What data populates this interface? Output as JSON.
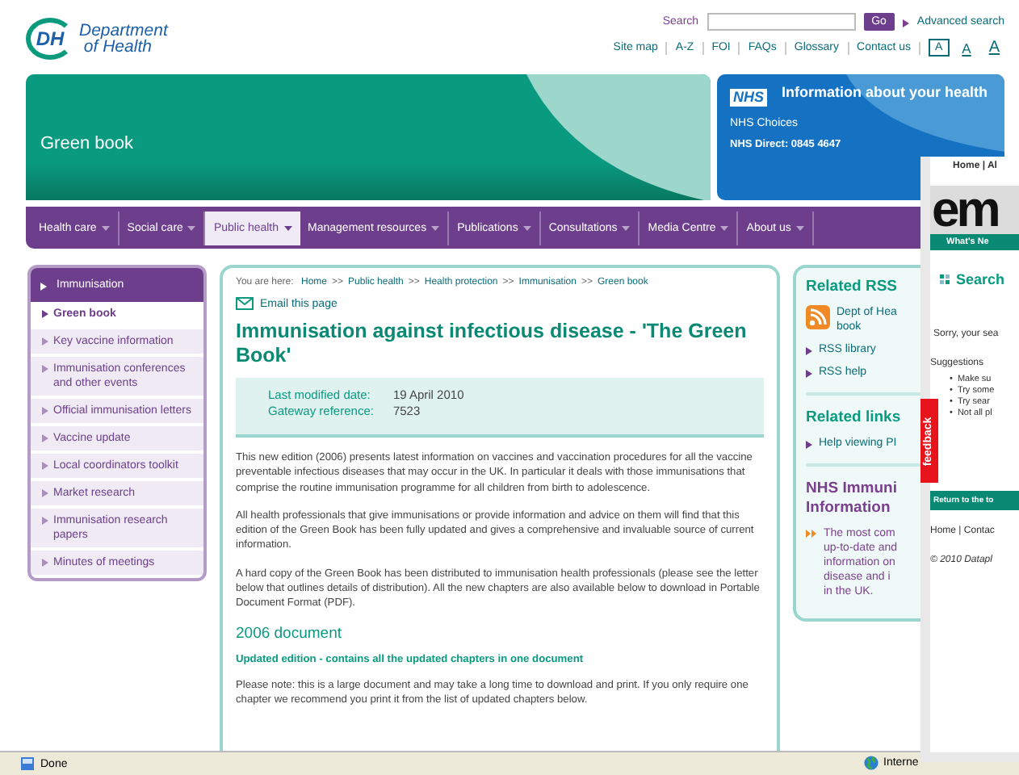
{
  "header": {
    "logo_mark": "DH",
    "logo_line1": "Department",
    "logo_line2": "of Health",
    "search_label": "Search",
    "go_button": "Go",
    "advanced_search": "Advanced search",
    "top_links": [
      "Site map",
      "A-Z",
      "FOI",
      "FAQs",
      "Glossary",
      "Contact us"
    ],
    "text_sizes": [
      {
        "label": "A",
        "selected": true
      },
      {
        "label": "A",
        "selected": false
      },
      {
        "label": "A",
        "selected": false
      }
    ]
  },
  "banner": {
    "title": "Green book",
    "nhs_logo": "NHS",
    "nhs_heading": "Information about your health",
    "nhs_link": "NHS Choices",
    "nhs_phone": "NHS Direct: 0845 4647"
  },
  "nav": [
    {
      "label": "Health care",
      "selected": false
    },
    {
      "label": "Social care",
      "selected": false
    },
    {
      "label": "Public health",
      "selected": true
    },
    {
      "label": "Management resources",
      "selected": false
    },
    {
      "label": "Publications",
      "selected": false
    },
    {
      "label": "Consultations",
      "selected": false
    },
    {
      "label": "Media Centre",
      "selected": false
    },
    {
      "label": "About us",
      "selected": false
    }
  ],
  "sidebar": {
    "heading": "Immunisation",
    "items": [
      {
        "label": "Green book",
        "selected": true
      },
      {
        "label": "Key vaccine information",
        "selected": false
      },
      {
        "label": "Immunisation conferences and other events",
        "selected": false
      },
      {
        "label": "Official immunisation letters",
        "selected": false
      },
      {
        "label": "Vaccine update",
        "selected": false
      },
      {
        "label": "Local coordinators toolkit",
        "selected": false
      },
      {
        "label": "Market research",
        "selected": false
      },
      {
        "label": "Immunisation research papers",
        "selected": false
      },
      {
        "label": "Minutes of meetings",
        "selected": false
      }
    ]
  },
  "main": {
    "breadcrumb_label": "You are here:",
    "breadcrumb": [
      "Home",
      "Public health",
      "Health protection",
      "Immunisation",
      "Green book"
    ],
    "breadcrumb_separator": ">>",
    "email_link": "Email this page",
    "title": "Immunisation against infectious disease - 'The Green Book'",
    "meta": [
      {
        "label": "Last modified date:",
        "value": "19 April 2010"
      },
      {
        "label": "Gateway reference:",
        "value": "7523"
      }
    ],
    "paragraphs": [
      "This new edition (2006) presents latest information on vaccines and vaccination procedures for all the vaccine preventable infectious diseases that may occur in the UK. In particular it deals with those immunisations that comprise the routine immunisation programme for all children from birth to adolescence.",
      "All health professionals that give immunisations or provide information and advice on them will find that this edition of the Green Book has been fully updated and gives a comprehensive and invaluable source of current information.",
      "A hard copy of the Green Book has been distributed to immunisation health professionals (please see the letter below that outlines details of distribution). All the new chapters are also available below to download in Portable Document Format (PDF)."
    ],
    "section_heading": "2006 document",
    "subheading": "Updated edition - contains all the updated chapters in one document",
    "note": "Please note: this is a large document and may take a long time to download and print.  If you only require one chapter we recommend you print it from the list of updated chapters below."
  },
  "right": {
    "rss_heading": "Related RSS",
    "rss_feed": [
      "Dept of Hea",
      "book"
    ],
    "rss_links": [
      "RSS library",
      "RSS help"
    ],
    "links_heading": "Related links",
    "links": [
      "Help viewing PI"
    ],
    "nhs_heading": [
      "NHS Immuni",
      "Information"
    ],
    "nhs_link": [
      "The most com",
      "up-to-date and",
      "information on",
      "disease and i",
      "in the UK."
    ]
  },
  "popup": {
    "top_links": "Home | Al",
    "logo": "em",
    "tagline": "What's Ne",
    "search_heading": "Search",
    "message": "Sorry, your sea",
    "suggestions_label": "Suggestions",
    "bullet": "•",
    "suggestions": [
      "Make su",
      "Try some",
      "Try sear",
      "Not all pl"
    ],
    "return_link": "Return to the to",
    "footer_links": "Home | Contac",
    "copyright": "© 2010 Datapl",
    "feedback": "feedback"
  },
  "status_bar": {
    "status": "Done",
    "zone": "Interne"
  }
}
